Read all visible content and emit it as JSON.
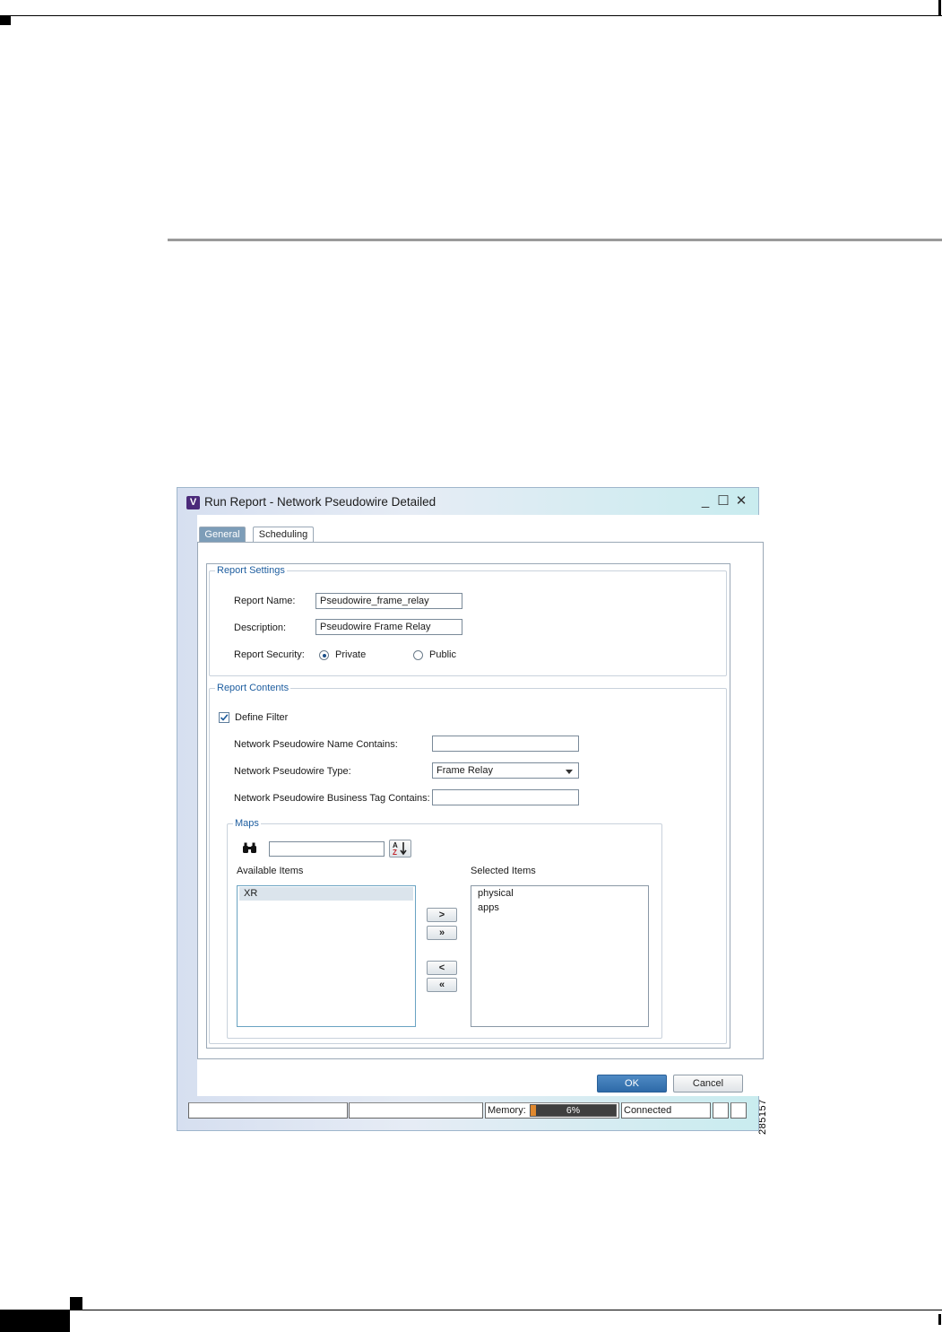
{
  "figure_id": "285157",
  "window": {
    "title": "Run Report - Network Pseudowire Detailed",
    "app_icon": "V",
    "controls": {
      "minimize": "minimize-icon",
      "maximize": "maximize-icon",
      "close": "close-icon"
    }
  },
  "tabs": [
    {
      "label": "General",
      "active": true
    },
    {
      "label": "Scheduling",
      "active": false
    }
  ],
  "report_settings": {
    "legend": "Report Settings",
    "name_label": "Report Name:",
    "name_value": "Pseudowire_frame_relay",
    "description_label": "Description:",
    "description_value": "Pseudowire Frame Relay",
    "security_label": "Report Security:",
    "security_options": [
      "Private",
      "Public"
    ],
    "security_selected": "Private"
  },
  "report_contents": {
    "legend": "Report Contents",
    "define_filter_label": "Define Filter",
    "define_filter_checked": true,
    "name_contains_label": "Network Pseudowire Name Contains:",
    "name_contains_value": "",
    "type_label": "Network Pseudowire Type:",
    "type_value": "Frame Relay",
    "business_tag_label": "Network Pseudowire Business Tag Contains:",
    "business_tag_value": ""
  },
  "maps": {
    "legend": "Maps",
    "search_icon": "binoculars-icon",
    "search_value": "",
    "sort_icon": "sort-az-icon",
    "available_label": "Available Items",
    "available_items": [
      "XR"
    ],
    "selected_label": "Selected Items",
    "selected_items": [
      "physical",
      "apps"
    ],
    "move_buttons": {
      "add": ">",
      "add_all": "»",
      "remove": "<",
      "remove_all": "«"
    }
  },
  "buttons": {
    "ok": "OK",
    "cancel": "Cancel"
  },
  "status_bar": {
    "memory_label": "Memory:",
    "memory_percent": 6,
    "memory_text": "6%",
    "connection": "Connected"
  }
}
